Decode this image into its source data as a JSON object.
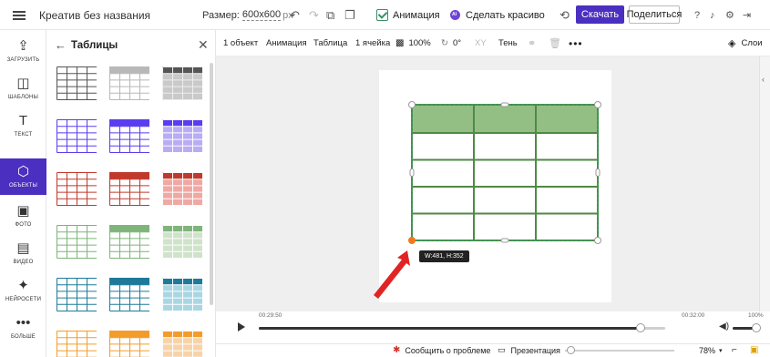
{
  "app": {
    "doc_title": "Креатив без названия",
    "size_label": "Размер:",
    "size_value": "600x600",
    "size_unit": "px",
    "animation_label": "Анимация",
    "ai_label": "Сделать красиво",
    "download_label": "Скачать",
    "share_label": "Поделиться",
    "accent_color": "#4a2fc0"
  },
  "sidebar": {
    "items": [
      {
        "label": "ЗАГРУЗИТЬ",
        "icon": "upload-icon",
        "glyph": "⇪",
        "active": false
      },
      {
        "label": "ШАБЛОНЫ",
        "icon": "templates-icon",
        "glyph": "◫",
        "active": false
      },
      {
        "label": "ТЕКСТ",
        "icon": "text-icon",
        "glyph": "T",
        "active": false
      },
      {
        "label": "ОБЪЕКТЫ",
        "icon": "shapes-icon",
        "glyph": "⬡",
        "active": true
      },
      {
        "label": "ФОТО",
        "icon": "photo-icon",
        "glyph": "▣",
        "active": false
      },
      {
        "label": "ВИДЕО",
        "icon": "video-icon",
        "glyph": "▤",
        "active": false
      },
      {
        "label": "НЕЙРОСЕТИ",
        "icon": "magic-wand-icon",
        "glyph": "✦",
        "active": false
      },
      {
        "label": "БОЛЬШЕ",
        "icon": "more-icon",
        "glyph": "•••",
        "active": false
      }
    ]
  },
  "panel": {
    "title": "Таблицы",
    "colors": [
      "#555555",
      "#b8b8b8",
      "#5a3df0",
      "#c0392b",
      "#7fb47a",
      "#1f7a9a",
      "#f39c2b"
    ]
  },
  "toolbar": {
    "objects": "1 объект",
    "animation": "Анимация",
    "table": "Таблица",
    "cell": "1 ячейка",
    "opacity": "100%",
    "rotation": "0°",
    "xy": "XY",
    "shadow": "Тень",
    "layers": "Слои"
  },
  "canvas": {
    "dimension_tooltip": "W:481, H:352",
    "table_header_color": "#93bf85",
    "table_border_color": "#4f8a45",
    "table_rows": 5,
    "table_cols": 3
  },
  "timeline": {
    "current_time": "00:29:50",
    "total_time": "00:32:00",
    "progress": 0.94,
    "volume_label": "100%",
    "volume": 1.0
  },
  "statusbar": {
    "report_label": "Сообщить о проблеме",
    "presentation_label": "Презентация",
    "zoom": "78%"
  }
}
